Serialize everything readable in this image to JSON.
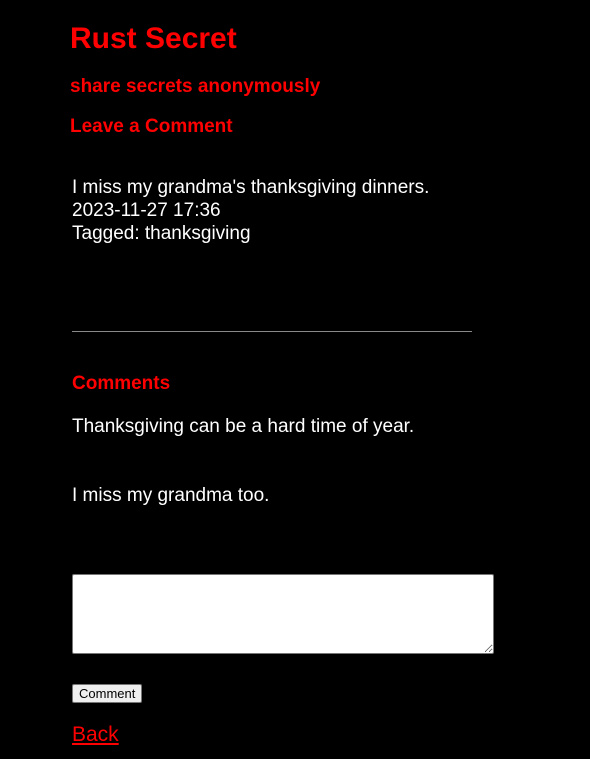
{
  "header": {
    "title": "Rust Secret",
    "tagline": "share secrets anonymously",
    "section_heading": "Leave a Comment"
  },
  "secret": {
    "text": "I miss my grandma's thanksgiving dinners.",
    "timestamp": "2023-11-27 17:36",
    "tags": "Tagged: thanksgiving"
  },
  "comments": {
    "heading": "Comments",
    "items": [
      "Thanksgiving can be a hard time of year.",
      "I miss my grandma too."
    ]
  },
  "form": {
    "textarea_value": "",
    "button_label": "Comment"
  },
  "nav": {
    "back_label": "Back"
  },
  "colors": {
    "background": "#000000",
    "accent": "#ff0000",
    "text": "#ffffff"
  }
}
